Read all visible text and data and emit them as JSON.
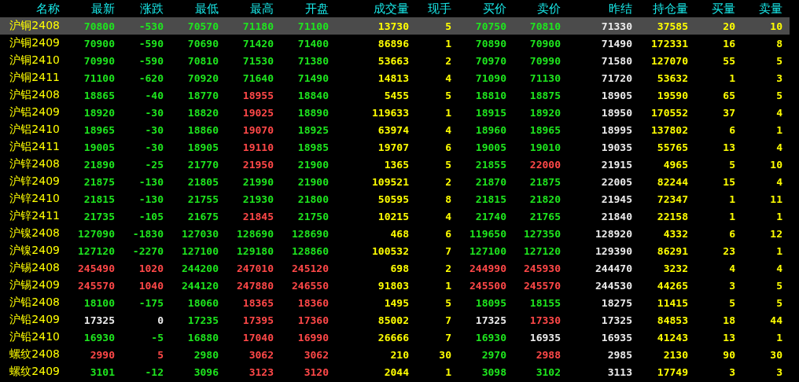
{
  "table": {
    "columns": [
      {
        "label": "名称",
        "kind": "name"
      },
      {
        "label": "最新",
        "kind": "price"
      },
      {
        "label": "涨跌",
        "kind": "price"
      },
      {
        "label": "最低",
        "kind": "price"
      },
      {
        "label": "最高",
        "kind": "price"
      },
      {
        "label": "开盘",
        "kind": "price"
      },
      {
        "label": "成交量",
        "kind": "volume"
      },
      {
        "label": "现手",
        "kind": "volume"
      },
      {
        "label": "买价",
        "kind": "price"
      },
      {
        "label": "卖价",
        "kind": "price"
      },
      {
        "label": "昨结",
        "kind": "settle"
      },
      {
        "label": "持仓量",
        "kind": "volume"
      },
      {
        "label": "买量",
        "kind": "volume"
      },
      {
        "label": "卖量",
        "kind": "volume"
      }
    ],
    "rows": [
      {
        "selected": true,
        "cells": [
          {
            "text": "沪铜2408"
          },
          {
            "text": "70800",
            "color": "#1ee61e"
          },
          {
            "text": "-530",
            "color": "#1ee61e"
          },
          {
            "text": "70570",
            "color": "#1ee61e"
          },
          {
            "text": "71180",
            "color": "#1ee61e"
          },
          {
            "text": "71100",
            "color": "#1ee61e"
          },
          {
            "text": "13730"
          },
          {
            "text": "5"
          },
          {
            "text": "70750",
            "color": "#1ee61e"
          },
          {
            "text": "70810",
            "color": "#1ee61e"
          },
          {
            "text": "71330"
          },
          {
            "text": "37585"
          },
          {
            "text": "20"
          },
          {
            "text": "10"
          }
        ]
      },
      {
        "selected": false,
        "cells": [
          {
            "text": "沪铜2409"
          },
          {
            "text": "70900",
            "color": "#1ee61e"
          },
          {
            "text": "-590",
            "color": "#1ee61e"
          },
          {
            "text": "70690",
            "color": "#1ee61e"
          },
          {
            "text": "71420",
            "color": "#1ee61e"
          },
          {
            "text": "71400",
            "color": "#1ee61e"
          },
          {
            "text": "86896"
          },
          {
            "text": "1"
          },
          {
            "text": "70890",
            "color": "#1ee61e"
          },
          {
            "text": "70900",
            "color": "#1ee61e"
          },
          {
            "text": "71490"
          },
          {
            "text": "172331"
          },
          {
            "text": "16"
          },
          {
            "text": "8"
          }
        ]
      },
      {
        "selected": false,
        "cells": [
          {
            "text": "沪铜2410"
          },
          {
            "text": "70990",
            "color": "#1ee61e"
          },
          {
            "text": "-590",
            "color": "#1ee61e"
          },
          {
            "text": "70810",
            "color": "#1ee61e"
          },
          {
            "text": "71530",
            "color": "#1ee61e"
          },
          {
            "text": "71380",
            "color": "#1ee61e"
          },
          {
            "text": "53663"
          },
          {
            "text": "2"
          },
          {
            "text": "70970",
            "color": "#1ee61e"
          },
          {
            "text": "70990",
            "color": "#1ee61e"
          },
          {
            "text": "71580"
          },
          {
            "text": "127070"
          },
          {
            "text": "55"
          },
          {
            "text": "5"
          }
        ]
      },
      {
        "selected": false,
        "cells": [
          {
            "text": "沪铜2411"
          },
          {
            "text": "71100",
            "color": "#1ee61e"
          },
          {
            "text": "-620",
            "color": "#1ee61e"
          },
          {
            "text": "70920",
            "color": "#1ee61e"
          },
          {
            "text": "71640",
            "color": "#1ee61e"
          },
          {
            "text": "71490",
            "color": "#1ee61e"
          },
          {
            "text": "14813"
          },
          {
            "text": "4"
          },
          {
            "text": "71090",
            "color": "#1ee61e"
          },
          {
            "text": "71130",
            "color": "#1ee61e"
          },
          {
            "text": "71720"
          },
          {
            "text": "53632"
          },
          {
            "text": "1"
          },
          {
            "text": "3"
          }
        ]
      },
      {
        "selected": false,
        "cells": [
          {
            "text": "沪铝2408"
          },
          {
            "text": "18865",
            "color": "#1ee61e"
          },
          {
            "text": "-40",
            "color": "#1ee61e"
          },
          {
            "text": "18770",
            "color": "#1ee61e"
          },
          {
            "text": "18955",
            "color": "#ff4848"
          },
          {
            "text": "18840",
            "color": "#1ee61e"
          },
          {
            "text": "5455"
          },
          {
            "text": "5"
          },
          {
            "text": "18810",
            "color": "#1ee61e"
          },
          {
            "text": "18875",
            "color": "#1ee61e"
          },
          {
            "text": "18905"
          },
          {
            "text": "19590"
          },
          {
            "text": "65"
          },
          {
            "text": "5"
          }
        ]
      },
      {
        "selected": false,
        "cells": [
          {
            "text": "沪铝2409"
          },
          {
            "text": "18920",
            "color": "#1ee61e"
          },
          {
            "text": "-30",
            "color": "#1ee61e"
          },
          {
            "text": "18820",
            "color": "#1ee61e"
          },
          {
            "text": "19025",
            "color": "#ff4848"
          },
          {
            "text": "18890",
            "color": "#1ee61e"
          },
          {
            "text": "119633"
          },
          {
            "text": "1"
          },
          {
            "text": "18915",
            "color": "#1ee61e"
          },
          {
            "text": "18920",
            "color": "#1ee61e"
          },
          {
            "text": "18950"
          },
          {
            "text": "170552"
          },
          {
            "text": "37"
          },
          {
            "text": "4"
          }
        ]
      },
      {
        "selected": false,
        "cells": [
          {
            "text": "沪铝2410"
          },
          {
            "text": "18965",
            "color": "#1ee61e"
          },
          {
            "text": "-30",
            "color": "#1ee61e"
          },
          {
            "text": "18860",
            "color": "#1ee61e"
          },
          {
            "text": "19070",
            "color": "#ff4848"
          },
          {
            "text": "18925",
            "color": "#1ee61e"
          },
          {
            "text": "63974"
          },
          {
            "text": "4"
          },
          {
            "text": "18960",
            "color": "#1ee61e"
          },
          {
            "text": "18965",
            "color": "#1ee61e"
          },
          {
            "text": "18995"
          },
          {
            "text": "137802"
          },
          {
            "text": "6"
          },
          {
            "text": "1"
          }
        ]
      },
      {
        "selected": false,
        "cells": [
          {
            "text": "沪铝2411"
          },
          {
            "text": "19005",
            "color": "#1ee61e"
          },
          {
            "text": "-30",
            "color": "#1ee61e"
          },
          {
            "text": "18905",
            "color": "#1ee61e"
          },
          {
            "text": "19110",
            "color": "#ff4848"
          },
          {
            "text": "18985",
            "color": "#1ee61e"
          },
          {
            "text": "19707"
          },
          {
            "text": "6"
          },
          {
            "text": "19005",
            "color": "#1ee61e"
          },
          {
            "text": "19010",
            "color": "#1ee61e"
          },
          {
            "text": "19035"
          },
          {
            "text": "55765"
          },
          {
            "text": "13"
          },
          {
            "text": "4"
          }
        ]
      },
      {
        "selected": false,
        "cells": [
          {
            "text": "沪锌2408"
          },
          {
            "text": "21890",
            "color": "#1ee61e"
          },
          {
            "text": "-25",
            "color": "#1ee61e"
          },
          {
            "text": "21770",
            "color": "#1ee61e"
          },
          {
            "text": "21950",
            "color": "#ff4848"
          },
          {
            "text": "21900",
            "color": "#1ee61e"
          },
          {
            "text": "1365"
          },
          {
            "text": "5"
          },
          {
            "text": "21855",
            "color": "#1ee61e"
          },
          {
            "text": "22000",
            "color": "#ff4848"
          },
          {
            "text": "21915"
          },
          {
            "text": "4965"
          },
          {
            "text": "5"
          },
          {
            "text": "10"
          }
        ]
      },
      {
        "selected": false,
        "cells": [
          {
            "text": "沪锌2409"
          },
          {
            "text": "21875",
            "color": "#1ee61e"
          },
          {
            "text": "-130",
            "color": "#1ee61e"
          },
          {
            "text": "21805",
            "color": "#1ee61e"
          },
          {
            "text": "21990",
            "color": "#1ee61e"
          },
          {
            "text": "21900",
            "color": "#1ee61e"
          },
          {
            "text": "109521"
          },
          {
            "text": "2"
          },
          {
            "text": "21870",
            "color": "#1ee61e"
          },
          {
            "text": "21875",
            "color": "#1ee61e"
          },
          {
            "text": "22005"
          },
          {
            "text": "82244"
          },
          {
            "text": "15"
          },
          {
            "text": "4"
          }
        ]
      },
      {
        "selected": false,
        "cells": [
          {
            "text": "沪锌2410"
          },
          {
            "text": "21815",
            "color": "#1ee61e"
          },
          {
            "text": "-130",
            "color": "#1ee61e"
          },
          {
            "text": "21755",
            "color": "#1ee61e"
          },
          {
            "text": "21930",
            "color": "#1ee61e"
          },
          {
            "text": "21800",
            "color": "#1ee61e"
          },
          {
            "text": "50595"
          },
          {
            "text": "8"
          },
          {
            "text": "21815",
            "color": "#1ee61e"
          },
          {
            "text": "21820",
            "color": "#1ee61e"
          },
          {
            "text": "21945"
          },
          {
            "text": "72347"
          },
          {
            "text": "1"
          },
          {
            "text": "11"
          }
        ]
      },
      {
        "selected": false,
        "cells": [
          {
            "text": "沪锌2411"
          },
          {
            "text": "21735",
            "color": "#1ee61e"
          },
          {
            "text": "-105",
            "color": "#1ee61e"
          },
          {
            "text": "21675",
            "color": "#1ee61e"
          },
          {
            "text": "21845",
            "color": "#ff4848"
          },
          {
            "text": "21750",
            "color": "#1ee61e"
          },
          {
            "text": "10215"
          },
          {
            "text": "4"
          },
          {
            "text": "21740",
            "color": "#1ee61e"
          },
          {
            "text": "21765",
            "color": "#1ee61e"
          },
          {
            "text": "21840"
          },
          {
            "text": "22158"
          },
          {
            "text": "1"
          },
          {
            "text": "1"
          }
        ]
      },
      {
        "selected": false,
        "cells": [
          {
            "text": "沪镍2408"
          },
          {
            "text": "127090",
            "color": "#1ee61e"
          },
          {
            "text": "-1830",
            "color": "#1ee61e"
          },
          {
            "text": "127030",
            "color": "#1ee61e"
          },
          {
            "text": "128690",
            "color": "#1ee61e"
          },
          {
            "text": "128690",
            "color": "#1ee61e"
          },
          {
            "text": "468"
          },
          {
            "text": "6"
          },
          {
            "text": "119650",
            "color": "#1ee61e"
          },
          {
            "text": "127350",
            "color": "#1ee61e"
          },
          {
            "text": "128920"
          },
          {
            "text": "4332"
          },
          {
            "text": "6"
          },
          {
            "text": "12"
          }
        ]
      },
      {
        "selected": false,
        "cells": [
          {
            "text": "沪镍2409"
          },
          {
            "text": "127120",
            "color": "#1ee61e"
          },
          {
            "text": "-2270",
            "color": "#1ee61e"
          },
          {
            "text": "127100",
            "color": "#1ee61e"
          },
          {
            "text": "129180",
            "color": "#1ee61e"
          },
          {
            "text": "128860",
            "color": "#1ee61e"
          },
          {
            "text": "100532"
          },
          {
            "text": "7"
          },
          {
            "text": "127100",
            "color": "#1ee61e"
          },
          {
            "text": "127120",
            "color": "#1ee61e"
          },
          {
            "text": "129390"
          },
          {
            "text": "86291"
          },
          {
            "text": "23"
          },
          {
            "text": "1"
          }
        ]
      },
      {
        "selected": false,
        "cells": [
          {
            "text": "沪锡2408"
          },
          {
            "text": "245490",
            "color": "#ff4848"
          },
          {
            "text": "1020",
            "color": "#ff4848"
          },
          {
            "text": "244200",
            "color": "#1ee61e"
          },
          {
            "text": "247010",
            "color": "#ff4848"
          },
          {
            "text": "245120",
            "color": "#ff4848"
          },
          {
            "text": "698"
          },
          {
            "text": "2"
          },
          {
            "text": "244990",
            "color": "#ff4848"
          },
          {
            "text": "245930",
            "color": "#ff4848"
          },
          {
            "text": "244470"
          },
          {
            "text": "3232"
          },
          {
            "text": "4"
          },
          {
            "text": "4"
          }
        ]
      },
      {
        "selected": false,
        "cells": [
          {
            "text": "沪锡2409"
          },
          {
            "text": "245570",
            "color": "#ff4848"
          },
          {
            "text": "1040",
            "color": "#ff4848"
          },
          {
            "text": "244120",
            "color": "#1ee61e"
          },
          {
            "text": "247880",
            "color": "#ff4848"
          },
          {
            "text": "246550",
            "color": "#ff4848"
          },
          {
            "text": "91803"
          },
          {
            "text": "1"
          },
          {
            "text": "245500",
            "color": "#ff4848"
          },
          {
            "text": "245570",
            "color": "#ff4848"
          },
          {
            "text": "244530"
          },
          {
            "text": "44265"
          },
          {
            "text": "3"
          },
          {
            "text": "5"
          }
        ]
      },
      {
        "selected": false,
        "cells": [
          {
            "text": "沪铅2408"
          },
          {
            "text": "18100",
            "color": "#1ee61e"
          },
          {
            "text": "-175",
            "color": "#1ee61e"
          },
          {
            "text": "18060",
            "color": "#1ee61e"
          },
          {
            "text": "18365",
            "color": "#ff4848"
          },
          {
            "text": "18360",
            "color": "#ff4848"
          },
          {
            "text": "1495"
          },
          {
            "text": "5"
          },
          {
            "text": "18095",
            "color": "#1ee61e"
          },
          {
            "text": "18155",
            "color": "#1ee61e"
          },
          {
            "text": "18275"
          },
          {
            "text": "11415"
          },
          {
            "text": "5"
          },
          {
            "text": "5"
          }
        ]
      },
      {
        "selected": false,
        "cells": [
          {
            "text": "沪铅2409"
          },
          {
            "text": "17325",
            "color": "#ececec"
          },
          {
            "text": "0",
            "color": "#ececec"
          },
          {
            "text": "17235",
            "color": "#1ee61e"
          },
          {
            "text": "17395",
            "color": "#ff4848"
          },
          {
            "text": "17360",
            "color": "#ff4848"
          },
          {
            "text": "85002"
          },
          {
            "text": "7"
          },
          {
            "text": "17325",
            "color": "#ececec"
          },
          {
            "text": "17330",
            "color": "#ff4848"
          },
          {
            "text": "17325"
          },
          {
            "text": "84853"
          },
          {
            "text": "18"
          },
          {
            "text": "44"
          }
        ]
      },
      {
        "selected": false,
        "cells": [
          {
            "text": "沪铅2410"
          },
          {
            "text": "16930",
            "color": "#1ee61e"
          },
          {
            "text": "-5",
            "color": "#1ee61e"
          },
          {
            "text": "16880",
            "color": "#1ee61e"
          },
          {
            "text": "17040",
            "color": "#ff4848"
          },
          {
            "text": "16990",
            "color": "#ff4848"
          },
          {
            "text": "26666"
          },
          {
            "text": "7"
          },
          {
            "text": "16930",
            "color": "#1ee61e"
          },
          {
            "text": "16935",
            "color": "#ececec"
          },
          {
            "text": "16935"
          },
          {
            "text": "41243"
          },
          {
            "text": "13"
          },
          {
            "text": "1"
          }
        ]
      },
      {
        "selected": false,
        "cells": [
          {
            "text": "螺纹2408"
          },
          {
            "text": "2990",
            "color": "#ff4848"
          },
          {
            "text": "5",
            "color": "#ff4848"
          },
          {
            "text": "2980",
            "color": "#1ee61e"
          },
          {
            "text": "3062",
            "color": "#ff4848"
          },
          {
            "text": "3062",
            "color": "#ff4848"
          },
          {
            "text": "210"
          },
          {
            "text": "30"
          },
          {
            "text": "2970",
            "color": "#1ee61e"
          },
          {
            "text": "2988",
            "color": "#ff4848"
          },
          {
            "text": "2985"
          },
          {
            "text": "2130"
          },
          {
            "text": "90"
          },
          {
            "text": "30"
          }
        ]
      },
      {
        "selected": false,
        "cells": [
          {
            "text": "螺纹2409"
          },
          {
            "text": "3101",
            "color": "#1ee61e"
          },
          {
            "text": "-12",
            "color": "#1ee61e"
          },
          {
            "text": "3096",
            "color": "#1ee61e"
          },
          {
            "text": "3123",
            "color": "#ff4848"
          },
          {
            "text": "3120",
            "color": "#ff4848"
          },
          {
            "text": "2044"
          },
          {
            "text": "1"
          },
          {
            "text": "3098",
            "color": "#1ee61e"
          },
          {
            "text": "3102",
            "color": "#1ee61e"
          },
          {
            "text": "3113"
          },
          {
            "text": "17749"
          },
          {
            "text": "3"
          },
          {
            "text": "3"
          }
        ]
      }
    ]
  }
}
